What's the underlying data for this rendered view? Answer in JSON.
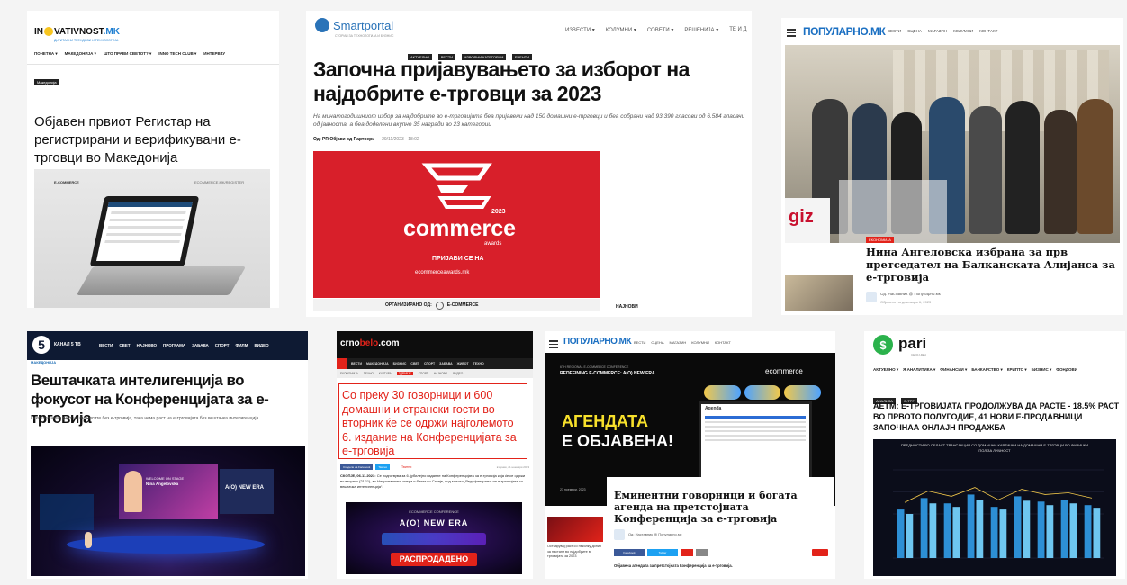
{
  "t1": {
    "logo_a": "IN",
    "logo_b": "VATIVNOST",
    "logo_c": ".MK",
    "logo_tagline": "ДИГИТАЛНИ ТРЕНДОВИ И ТЕХНОЛОГИЈА",
    "nav": [
      "ПОЧЕТНА ▾",
      "МАКЕДОНИЈА ▾",
      "ШТО ПРАВИ СВЕТОТ? ▾",
      "INNO TECH CLUB ▾",
      "ИНТЕРВЈУ"
    ],
    "tag": "Македонија",
    "headline": "Објавен првиот Регистар на регистрирани и верификувани е-трговци во Македонија",
    "laptop_brand": "E-COMMERCE",
    "laptop_right": "ECOMMERCE.MK/REGISTER"
  },
  "t2": {
    "logo": "Smartportal",
    "logo_sub": "СТОРИИ ЗА ТЕХНОЛОГИЈА И БИЗНИС",
    "nav": [
      "ИЗВЕСТИ ▾",
      "КОЛУМНИ ▾",
      "СОВЕТИ ▾",
      "РЕШЕНИЈА ▾",
      "ТЕ И Д"
    ],
    "tags": [
      "АКТУЕЛНО",
      "ВЕСТИ",
      "ИЗВОРНИ КАТЕГОРИИ",
      "ЕВЕНТИ"
    ],
    "headline": "Започна пријавувањето за изборот на најдобрите е-трговци за 2023",
    "subtitle": "На минатогодишниот избор за најдобрите во е-трговијата беа пријавени над 150 домашни е-трговци и беа собрани над 93.390 гласови од 6.584 гласачи од јавноста, а беа доделени вкупно 35 награди во 23 категории",
    "byline": "Од: PR Објави од Партнери",
    "date": "— 29/11/2023 - 18:02",
    "banner_year": "2023",
    "banner_title": "commerce",
    "banner_sub": "awards",
    "banner_cta": "ПРИЈАВИ СЕ НА",
    "banner_url": "ecommerceawards.mk",
    "organizer_label": "ОРГАНИЗИРАНО ОД:",
    "organizer_name": "E-COMMERCE",
    "side_label": "НАЈНОВИ"
  },
  "t3": {
    "logo": "ПОПУЛАРНО.МК",
    "nav": [
      "ВЕСТИ",
      "СЦЕНА",
      "МАГАЗИН",
      "КОЛУМНИ",
      "КОНТАКТ"
    ],
    "photo_sign": "giz",
    "tag": "ЕКОНОМИЈА",
    "headline": "Нина Ангеловска избрана за прв претседател на Балканската Алијанса за е-трговија",
    "byline": "Од: Наставник @ Популарно.мк",
    "date": "Објавено на декември 6, 2023"
  },
  "t4": {
    "logo_num": "5",
    "logo_txt": "КАНАЛ 5 ТВ",
    "nav": [
      "ВЕСТИ",
      "СВЕТ",
      "НАЈНОВО",
      "ПРОГРАМА",
      "ЗАБАВА",
      "СПОРТ",
      "ФИЛМ",
      "ВИДЕО"
    ],
    "tag": "МАКЕДОНИЈА",
    "headline": "Вештачката интелигенција во фокусот на Конференцијата за е-трговија",
    "summary": "Како што нема раст на бизнисите без е-трговија, така нема раст на е-трговијата без вештачка интелигенција",
    "screen_line1": "WELCOME ON STAGE",
    "screen_line2": "Nina Angelovska",
    "stage_sign": "A(O) NEW ERA"
  },
  "t5": {
    "logo_a": "crno",
    "logo_b": "belo",
    "logo_c": ".com",
    "nav": [
      "ВЕСТИ",
      "МАКЕДОНИЈА",
      "БИЗНИС",
      "СВЕТ",
      "СПОРТ",
      "ЗАБАВА",
      "ЖИВОТ",
      "ТЕХНО"
    ],
    "subnav": [
      "ЕКОНОМИЈА",
      "ТЕХНО",
      "КУЛТУРА",
      "ЗДРАВЈЕ",
      "СПОРТ",
      "НАЈНОВО",
      "ВИДЕО"
    ],
    "headline": "Со преку 30 говорници и 600 домашни и странски гости во вторник ќе се одржи најголемото 6. издание на Конференцијата за е-трговија",
    "share1": "Сподели на Facebook",
    "share2": "Твитни",
    "share_tag": "Твитни",
    "date": "вторник, 21 ноември 2023",
    "body_lead": "СКОПЈЕ, 06.11.2023:",
    "body": "Се подготвува за 6. јубилејно издание на Конференцијата за е-трговија која ќе се одржи во вторник (21.11), во Националната опера и балет во Скопје, под мотото „Редефинирање на е-трговијата со вештачка интелигенција“.",
    "banner_top": "ECOMMERCE CONFERENCE",
    "banner_mid": "A(O) NEW ERA",
    "banner_sold": "РАСПРОДАДЕНО"
  },
  "t6": {
    "logo": "ПОПУЛАРНО.МК",
    "nav": [
      "ВЕСТИ",
      "СЦЕНА",
      "МАГАЗИН",
      "КОЛУМНИ",
      "КОНТАКТ"
    ],
    "promo_top": "6TH REGIONAL E-COMMERCE CONFERENCE",
    "promo_title": "REDEFINING E-COMMERCE: A(O) NEW ERA",
    "promo_brand": "ecommerce",
    "promo_agenda_a": "АГЕНДАТА",
    "promo_agenda_b": "Е ОБЈАВЕНА!",
    "screen_title": "Agenda",
    "side_caption": "Остварувај раст со неколку допир за настапи во најдобрите в трговијата за 2023",
    "date": "23 ноември, 2023",
    "headline": "Еминентни говорници и богата агенда на претстојната Конференција за е-трговија",
    "byline": "Од: Наставник @ Популарно.мк",
    "share_labels": [
      "Facebook",
      "Twitter",
      "",
      ""
    ],
    "lead": "Објавена агендата за претстојната Конференција за е-трговија."
  },
  "t7": {
    "logo": "pari",
    "logo_sub": "СЕКОЈ ДЕН",
    "nav": [
      "АКТУЕЛНО ▾",
      "Я АНАЛИТИКА ▾",
      "ФИНАНСИИ ▾",
      "БАНКАРСТВО ▾",
      "КРИПТО ▾",
      "БИЗНИС ▾",
      "ФОНДОВИ"
    ],
    "tags": [
      "АНАЛИЗА",
      "Е-ТРГ"
    ],
    "headline": "АЕТМ: Е-ТРГОВИЈАТА ПРОДОЛЖУВА ДА РАСТЕ - 18.5% РАСТ ВО ПРВОТО ПОЛУГОДИЕ, 41 НОВИ Е-ПРОДАВНИЦИ ЗАПОЧНАА ОНЛАЈН ПРОДАЖБА",
    "chart_title": "ПРЕДНОСТИ ВО ОБЛАСТ ТРАНСАКЦИИ СО ДОМАШНИ КАРТИЧКИ НА ДОМАШНИ Е-ТРГОВЦИ ВО ФИЗИЧКИ ПОЛ ЗА ЛИЧНОСТ"
  },
  "chart_data": {
    "type": "bar",
    "categories": [
      "",
      "",
      "",
      "",
      "",
      "",
      "",
      "",
      ""
    ],
    "series": [
      {
        "name": "",
        "values": [
          55,
          68,
          62,
          72,
          58,
          70,
          64,
          66,
          60
        ]
      },
      {
        "name": "",
        "values": [
          50,
          62,
          58,
          66,
          55,
          65,
          60,
          62,
          57
        ]
      }
    ],
    "colors": [
      "#2d8fd5",
      "#6ec6f0"
    ]
  },
  "colors": {
    "red": "#e2231a",
    "dark": "#0d0d0d",
    "blue": "#1f6fb5",
    "green": "#2bb24c"
  }
}
